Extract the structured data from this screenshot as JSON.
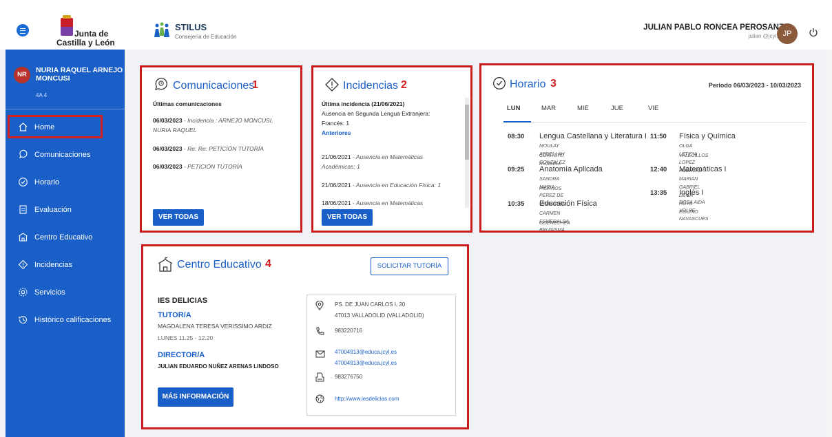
{
  "header": {
    "brand_line1": "Junta de",
    "brand_line2": "Castilla y León",
    "app_name": "STILUS",
    "app_sub": "Consejería de Educación",
    "user_name": "JULIAN PABLO RONCEA PEROSANZ",
    "user_email": "julian @jcyl.es",
    "user_initials": "JP"
  },
  "sidebar": {
    "student_initials": "NR",
    "student_name": "NURIA RAQUEL ARNEJO MONCUSI",
    "student_group": "4A 4",
    "items": [
      {
        "label": "Home",
        "icon": "home-icon"
      },
      {
        "label": "Comunicaciones",
        "icon": "chat-icon"
      },
      {
        "label": "Horario",
        "icon": "clock-icon"
      },
      {
        "label": "Evaluación",
        "icon": "evaluation-icon"
      },
      {
        "label": "Centro Educativo",
        "icon": "school-icon"
      },
      {
        "label": "Incidencias",
        "icon": "warning-icon"
      },
      {
        "label": "Servicios",
        "icon": "gear-icon"
      },
      {
        "label": "Histórico calificaciones",
        "icon": "history-icon"
      }
    ]
  },
  "comunicaciones": {
    "title": "Comunicaciones",
    "number": "1",
    "subtitle": "Últimas comunicaciones",
    "items": [
      {
        "date": "06/03/2023",
        "text": " - Incidencia : ARNEJO MONCUSI,",
        "text2": "NURIA RAQUEL"
      },
      {
        "date": "06/03/2023",
        "text": " - Re: Re: PETICIÓN TUTORÍA",
        "text2": ""
      },
      {
        "date": "06/03/2023",
        "text": " - PETICIÓN TUTORÍA",
        "text2": ""
      }
    ],
    "button": "VER TODAS"
  },
  "incidencias": {
    "title": "Incidencias",
    "number": "2",
    "last_label": "Última incidencia (21/06/2021)",
    "last_text1": "Ausencia en Segunda Lengua Extranjera:",
    "last_text2": "Francés: 1",
    "anteriores": "Anteriores",
    "items": [
      {
        "date": "21/06/2021",
        "text": " - Ausencia en Matemáticas",
        "text2": "Académicas: 1"
      },
      {
        "date": "21/06/2021",
        "text": " - Ausencia en Educación Física: 1",
        "text2": ""
      },
      {
        "date": "18/06/2021",
        "text": " - Ausencia en Matemáticas",
        "text2": ""
      }
    ],
    "button": "VER TODAS"
  },
  "horario": {
    "title": "Horario",
    "number": "3",
    "periodo": "Periodo 06/03/2023 - 10/03/2023",
    "days": [
      "LUN",
      "MAR",
      "MIE",
      "JUE",
      "VIE"
    ],
    "col1": [
      {
        "time": "08:30",
        "subject": "Lengua Castellana y Literatura I",
        "t1": "MOULAY ABDELLAH GONZALEZ",
        "t2": "CORROTO RUSSELL"
      },
      {
        "time": "09:25",
        "subject": "Anatomía Aplicada",
        "t1": "SANDRA MARIA PEREZ DE URABAYEN",
        "t2": "PIORNOS"
      },
      {
        "time": "10:35",
        "subject": "Educación Física",
        "t1": "CARMEN ESMERALDA BRUINSMA",
        "t2": "GOENECHEA"
      }
    ],
    "col2": [
      {
        "time": "11:50",
        "subject": "Física y Química",
        "t1": "OLGA LETICIA LOPEZ HUERTAS",
        "t2": "VALECILLOS"
      },
      {
        "time": "12:40",
        "subject": "Matemáticas I",
        "t1": "MARIAN GABRIEL DE LA HOYA EGUINO",
        "t2": ""
      },
      {
        "time": "13:35",
        "subject": "Inglés I",
        "t1": "ROSA AIDA VOLPE NAVASCUES",
        "t2": ""
      }
    ]
  },
  "centro": {
    "title": "Centro Educativo",
    "number": "4",
    "button_tutoria": "SOLICITAR TUTORÍA",
    "school": "IES DELICIAS",
    "tutor_label": "TUTOR/A",
    "tutor_name": "MAGDALENA TERESA VERISSIMO ARDIZ",
    "tutor_hours": "LUNES 11.25 - 12.20",
    "director_label": "DIRECTOR/A",
    "director_name": "JULIAN EDUARDO NUÑEZ ARENAS LINDOSO",
    "button_info": "MÁS INFORMACIÓN",
    "address1": "PS. DE JUAN CARLOS I, 20",
    "address2": "47013 VALLADOLID (VALLADOLID)",
    "phone": "983220716",
    "email1": "47004913@educa.jcyl.es",
    "email2": "47004913@educa.jcyl.es",
    "fax": "983276750",
    "web": "http://www.iesdelicias.com"
  },
  "colors": {
    "primary": "#1a5fc7",
    "highlight": "#c91c1c"
  }
}
